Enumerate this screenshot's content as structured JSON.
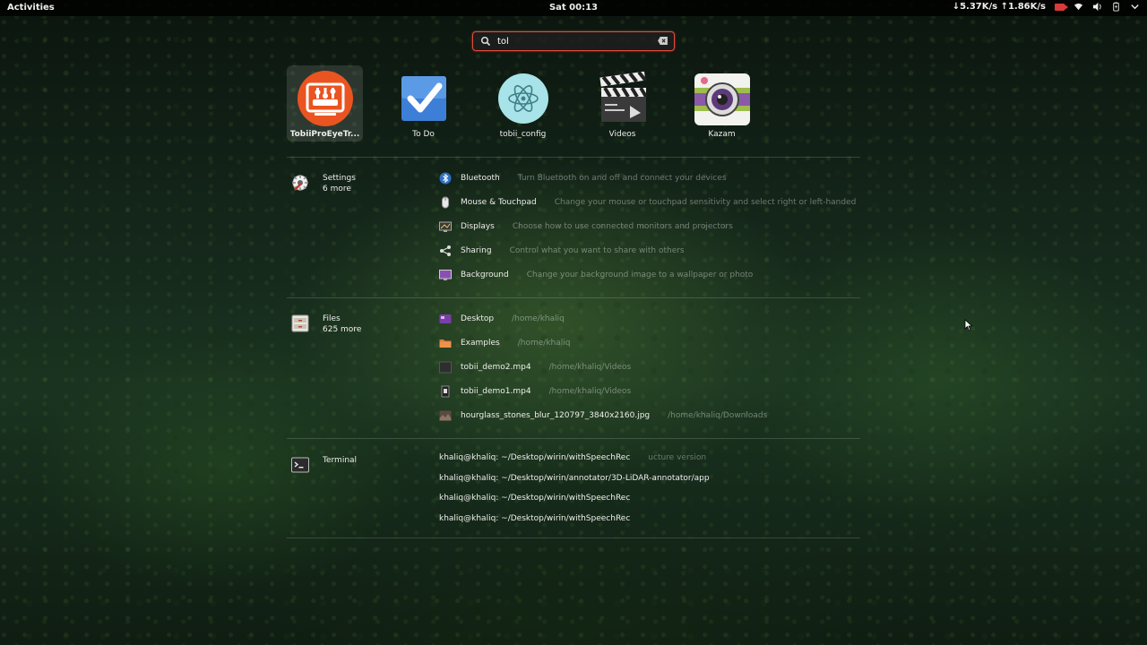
{
  "topbar": {
    "activities": "Activities",
    "clock": "Sat 00:13",
    "netspeed": "↓5.37K/s ↑1.86K/s"
  },
  "search": {
    "value": "tol"
  },
  "apps": [
    {
      "label": "TobiiProEyeTr...",
      "icon": "tobii-pro-eyetracker-icon"
    },
    {
      "label": "To Do",
      "icon": "todo-check-icon"
    },
    {
      "label": "tobii_config",
      "icon": "electron-atom-icon"
    },
    {
      "label": "Videos",
      "icon": "clapperboard-icon"
    },
    {
      "label": "Kazam",
      "icon": "camera-icon"
    }
  ],
  "settings": {
    "name": "Settings",
    "more": "6 more",
    "items": [
      {
        "name": "Bluetooth",
        "desc": "Turn Bluetooth on and off and connect your devices"
      },
      {
        "name": "Mouse & Touchpad",
        "desc": "Change your mouse or touchpad sensitivity and select right or left-handed"
      },
      {
        "name": "Displays",
        "desc": "Choose how to use connected monitors and projectors"
      },
      {
        "name": "Sharing",
        "desc": "Control what you want to share with others"
      },
      {
        "name": "Background",
        "desc": "Change your background image to a wallpaper or photo"
      }
    ]
  },
  "files": {
    "name": "Files",
    "more": "625 more",
    "items": [
      {
        "name": "Desktop",
        "desc": "/home/khaliq"
      },
      {
        "name": "Examples",
        "desc": "/home/khaliq"
      },
      {
        "name": "tobii_demo2.mp4",
        "desc": "/home/khaliq/Videos"
      },
      {
        "name": "tobii_demo1.mp4",
        "desc": "/home/khaliq/Videos"
      },
      {
        "name": "hourglass_stones_blur_120797_3840x2160.jpg",
        "desc": "/home/khaliq/Downloads"
      }
    ]
  },
  "terminal": {
    "name": "Terminal",
    "items": [
      {
        "name": "khaliq@khaliq: ~/Desktop/wirin/withSpeechRec",
        "desc": "ucture version"
      },
      {
        "name": "khaliq@khaliq: ~/Desktop/wirin/annotator/3D-LiDAR-annotator/app",
        "desc": ""
      },
      {
        "name": "khaliq@khaliq: ~/Desktop/wirin/withSpeechRec",
        "desc": ""
      },
      {
        "name": "khaliq@khaliq: ~/Desktop/wirin/withSpeechRec",
        "desc": ""
      }
    ]
  },
  "colors": {
    "accent": "#e24c3b",
    "tobii": "#e95420"
  }
}
